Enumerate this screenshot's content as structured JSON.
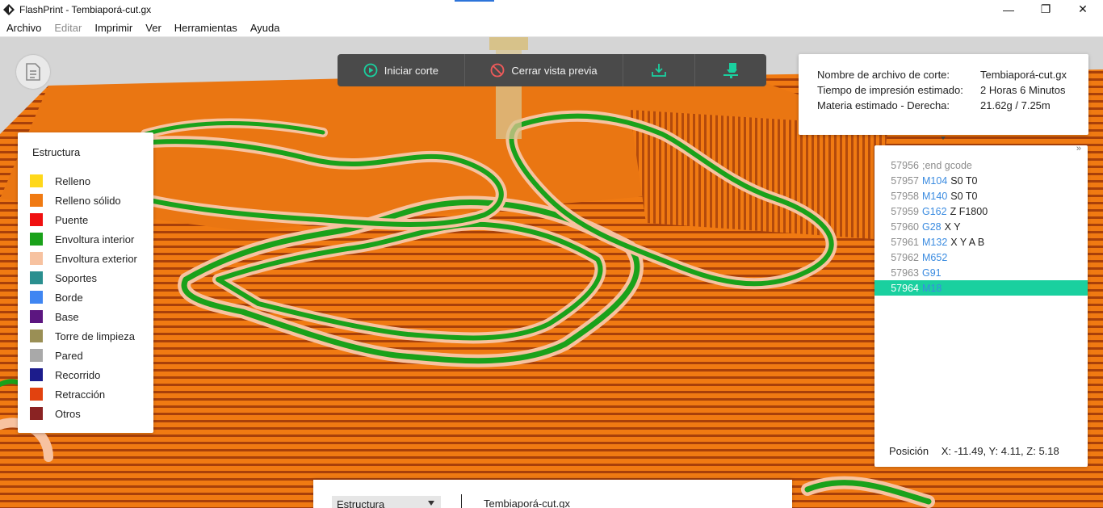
{
  "window": {
    "title": "FlashPrint - Tembiaporá-cut.gx",
    "minimize": "—",
    "maximize": "❐",
    "close": "✕"
  },
  "menu": [
    "Archivo",
    "Editar",
    "Imprimir",
    "Ver",
    "Herramientas",
    "Ayuda"
  ],
  "menu_disabled": [
    "Editar"
  ],
  "toolbar": {
    "start_slice": "Iniciar corte",
    "close_preview": "Cerrar vista previa"
  },
  "info": {
    "filename_label": "Nombre de archivo de corte:",
    "filename_value": "Tembiaporá-cut.gx",
    "time_label": "Tiempo de impresión estimado:",
    "time_value": "2 Horas 6 Minutos",
    "material_label": "Materia estimado - Derecha:",
    "material_value": "21.62g / 7.25m"
  },
  "gcode": {
    "lines": [
      {
        "n": "57956",
        "cmd": "",
        "args": ";end gcode",
        "comment": true
      },
      {
        "n": "57957",
        "cmd": "M104",
        "args": "S0 T0"
      },
      {
        "n": "57958",
        "cmd": "M140",
        "args": "S0 T0"
      },
      {
        "n": "57959",
        "cmd": "G162",
        "args": "Z F1800"
      },
      {
        "n": "57960",
        "cmd": "G28",
        "args": "X Y"
      },
      {
        "n": "57961",
        "cmd": "M132",
        "args": "X Y A B"
      },
      {
        "n": "57962",
        "cmd": "M652",
        "args": ""
      },
      {
        "n": "57963",
        "cmd": "G91",
        "args": ""
      },
      {
        "n": "57964",
        "cmd": "M18",
        "args": "",
        "active": true
      }
    ],
    "position_label": "Posición",
    "position_value": "X: -11.49, Y: 4.11, Z: 5.18"
  },
  "legend": {
    "title": "Estructura",
    "items": [
      {
        "label": "Relleno",
        "color": "#ffd81a"
      },
      {
        "label": "Relleno sólido",
        "color": "#f07a12"
      },
      {
        "label": "Puente",
        "color": "#f01010"
      },
      {
        "label": "Envoltura interior",
        "color": "#1aa11a"
      },
      {
        "label": "Envoltura exterior",
        "color": "#f7c2a0"
      },
      {
        "label": "Soportes",
        "color": "#2a8f8f"
      },
      {
        "label": "Borde",
        "color": "#3f86f2"
      },
      {
        "label": "Base",
        "color": "#5c1680"
      },
      {
        "label": "Torre de limpieza",
        "color": "#9a8f55"
      },
      {
        "label": "Pared",
        "color": "#a9a9a9"
      },
      {
        "label": "Recorrido",
        "color": "#1c1c8c"
      },
      {
        "label": "Retracción",
        "color": "#e2420f"
      },
      {
        "label": "Otros",
        "color": "#8a2323"
      }
    ]
  },
  "bottom": {
    "select_value": "Estructura",
    "filename": "Tembiaporá-cut.gx"
  },
  "colors": {
    "accent": "#1ad09f",
    "toolbar_bg": "#4a4a4a",
    "orange": "#f07a12",
    "green": "#1aa11a",
    "peach": "#f7c2a0"
  }
}
